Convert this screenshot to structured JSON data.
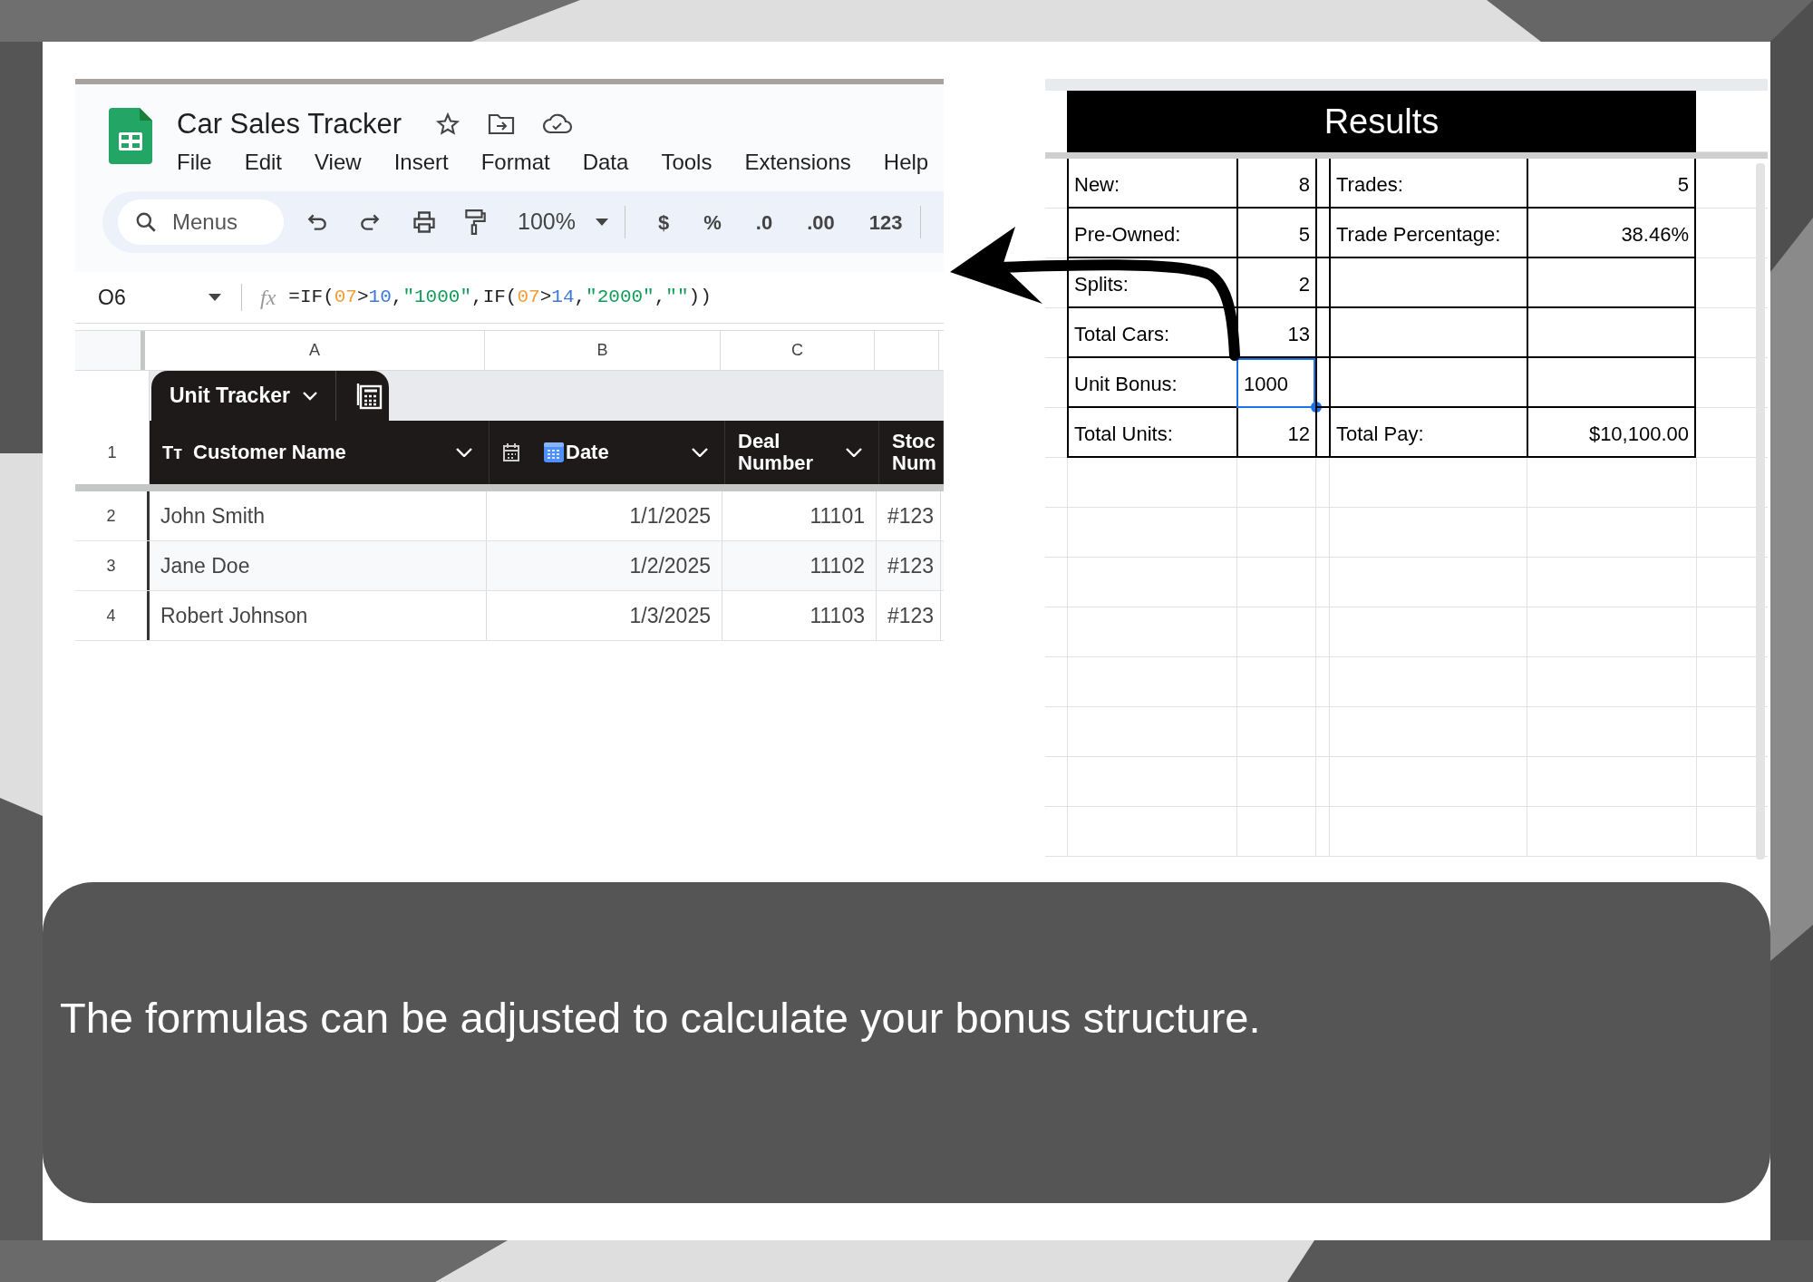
{
  "spreadsheet": {
    "title": "Car Sales Tracker",
    "menus": [
      "File",
      "Edit",
      "View",
      "Insert",
      "Format",
      "Data",
      "Tools",
      "Extensions",
      "Help"
    ],
    "toolbar": {
      "search_placeholder": "Menus",
      "zoom": "100%",
      "format_buttons": [
        "$",
        "%",
        ".0",
        ".00",
        "123"
      ]
    },
    "formula_bar": {
      "cell": "O6",
      "fx_label": "fx",
      "formula": [
        {
          "kind": "plain",
          "text": "=IF("
        },
        {
          "kind": "ref",
          "text": "07"
        },
        {
          "kind": "plain",
          "text": ">"
        },
        {
          "kind": "number",
          "text": "10"
        },
        {
          "kind": "plain",
          "text": ","
        },
        {
          "kind": "string",
          "text": "\"1000\""
        },
        {
          "kind": "plain",
          "text": ",IF("
        },
        {
          "kind": "ref",
          "text": "07"
        },
        {
          "kind": "plain",
          "text": ">"
        },
        {
          "kind": "number",
          "text": "14"
        },
        {
          "kind": "plain",
          "text": ","
        },
        {
          "kind": "string",
          "text": "\"2000\""
        },
        {
          "kind": "plain",
          "text": ","
        },
        {
          "kind": "string",
          "text": "\"\""
        },
        {
          "kind": "plain",
          "text": "))"
        }
      ]
    },
    "column_letters": [
      "A",
      "B",
      "C"
    ],
    "table_tab": "Unit Tracker",
    "header_row_number": "1",
    "headers": [
      {
        "kind": "text",
        "type_label": "Tт",
        "lines": [
          "Customer Name"
        ]
      },
      {
        "kind": "date",
        "lines": [
          "Date"
        ]
      },
      {
        "kind": "plain",
        "lines": [
          "Deal",
          "Number"
        ]
      },
      {
        "kind": "plain",
        "lines": [
          "Stoc",
          "Num"
        ]
      }
    ],
    "rows": [
      {
        "number": "2",
        "cells": [
          "John Smith",
          "1/1/2025",
          "11101",
          "#123"
        ]
      },
      {
        "number": "3",
        "cells": [
          "Jane Doe",
          "1/2/2025",
          "11102",
          "#123"
        ]
      },
      {
        "number": "4",
        "cells": [
          "Robert Johnson",
          "1/3/2025",
          "11103",
          "#123"
        ]
      }
    ]
  },
  "results": {
    "title": "Results",
    "rows": [
      {
        "label": "New:",
        "value": "8",
        "selected": false,
        "label_2": "Trades:",
        "value_2": "5"
      },
      {
        "label": "Pre-Owned:",
        "value": "5",
        "selected": false,
        "label_2": "Trade Percentage:",
        "value_2": "38.46%"
      },
      {
        "label": "Splits:",
        "value": "2",
        "selected": false
      },
      {
        "label": "Total Cars:",
        "value": "13",
        "selected": false
      },
      {
        "label": "Unit Bonus:",
        "value": "1000",
        "selected": true
      },
      {
        "label": "Total Units:",
        "value": "12",
        "selected": false,
        "label_2": "Total Pay:",
        "value_2": "$10,100.00"
      }
    ]
  },
  "caption": "The formulas can be adjusted to calculate your bonus structure."
}
